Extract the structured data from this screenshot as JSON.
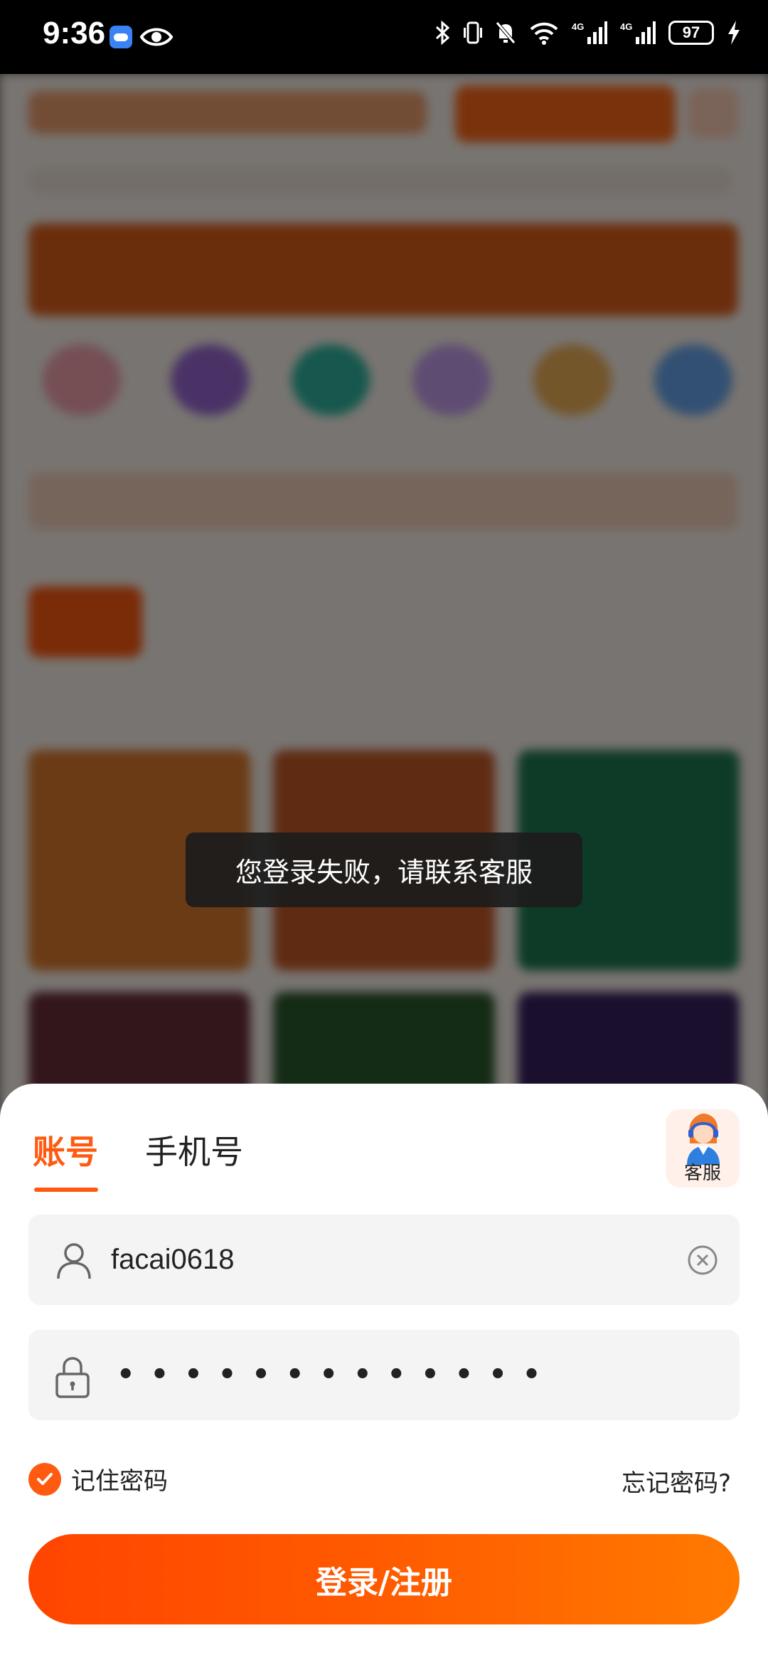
{
  "status_bar": {
    "time": "9:36",
    "battery": "97",
    "icons": [
      "cloud-icon",
      "eye-icon",
      "bluetooth-icon",
      "vibrate-icon",
      "mute-icon",
      "wifi-icon",
      "signal-4g-icon",
      "signal-4g-icon",
      "battery-icon",
      "charging-icon"
    ]
  },
  "toast": {
    "message": "您登录失败，请联系客服"
  },
  "login_sheet": {
    "tabs": [
      {
        "label": "账号",
        "active": true
      },
      {
        "label": "手机号",
        "active": false
      }
    ],
    "service_label": "客服",
    "username_value": "facai0618",
    "password_mask": "•••••••••••••",
    "remember_label": "记住密码",
    "remember_checked": true,
    "forgot_label": "忘记密码?",
    "login_button": "登录/注册"
  },
  "colors": {
    "accent": "#ff5a10",
    "button_gradient_start": "#ff4500",
    "button_gradient_end": "#ff7a00",
    "field_bg": "#f4f4f4"
  }
}
